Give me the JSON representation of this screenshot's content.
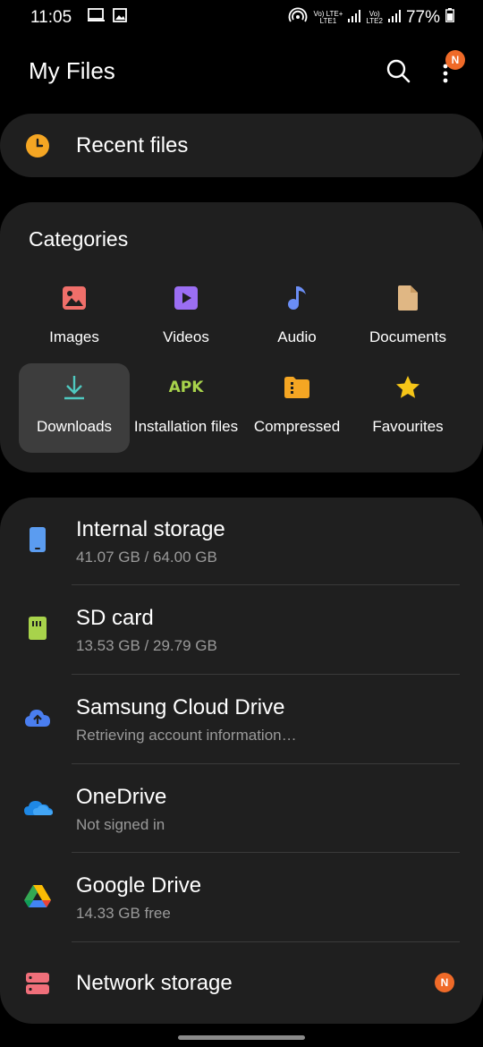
{
  "status_bar": {
    "time": "11:05",
    "lte1_top": "Vo) LTE+",
    "lte1_bottom": "LTE1",
    "lte2_top": "Vo)",
    "lte2_bottom": "LTE2",
    "battery": "77%"
  },
  "header": {
    "title": "My Files",
    "badge": "N"
  },
  "recent": {
    "label": "Recent files"
  },
  "categories": {
    "title": "Categories",
    "items": [
      {
        "label": "Images",
        "icon": "image-icon",
        "color": "#f06f6a"
      },
      {
        "label": "Videos",
        "icon": "video-icon",
        "color": "#9b6ef3"
      },
      {
        "label": "Audio",
        "icon": "music-note-icon",
        "color": "#6b8ef5"
      },
      {
        "label": "Documents",
        "icon": "document-icon",
        "color": "#e0b784"
      },
      {
        "label": "Downloads",
        "icon": "download-icon",
        "color": "#4fc9c0",
        "active": true
      },
      {
        "label": "Installation files",
        "icon": "apk-icon",
        "icon_text": "APK",
        "color": "#a8d34b"
      },
      {
        "label": "Compressed",
        "icon": "zip-folder-icon",
        "color": "#f5a623"
      },
      {
        "label": "Favourites",
        "icon": "star-icon",
        "color": "#f5c518"
      }
    ]
  },
  "storage": {
    "items": [
      {
        "name": "Internal storage",
        "sub": "41.07 GB / 64.00 GB",
        "icon": "phone-icon",
        "color": "#5b9cf0"
      },
      {
        "name": "SD card",
        "sub": "13.53 GB / 29.79 GB",
        "icon": "sd-card-icon",
        "color": "#a8d34b"
      },
      {
        "name": "Samsung Cloud Drive",
        "sub": "Retrieving account information…",
        "icon": "cloud-upload-icon",
        "color": "#4a7ef0"
      },
      {
        "name": "OneDrive",
        "sub": "Not signed in",
        "icon": "onedrive-icon",
        "color": "#1e88e5"
      },
      {
        "name": "Google Drive",
        "sub": "14.33 GB free",
        "icon": "google-drive-icon",
        "color": "#34a853"
      },
      {
        "name": "Network storage",
        "sub": "",
        "icon": "network-storage-icon",
        "color": "#f06f7a",
        "badge": "N"
      }
    ]
  }
}
